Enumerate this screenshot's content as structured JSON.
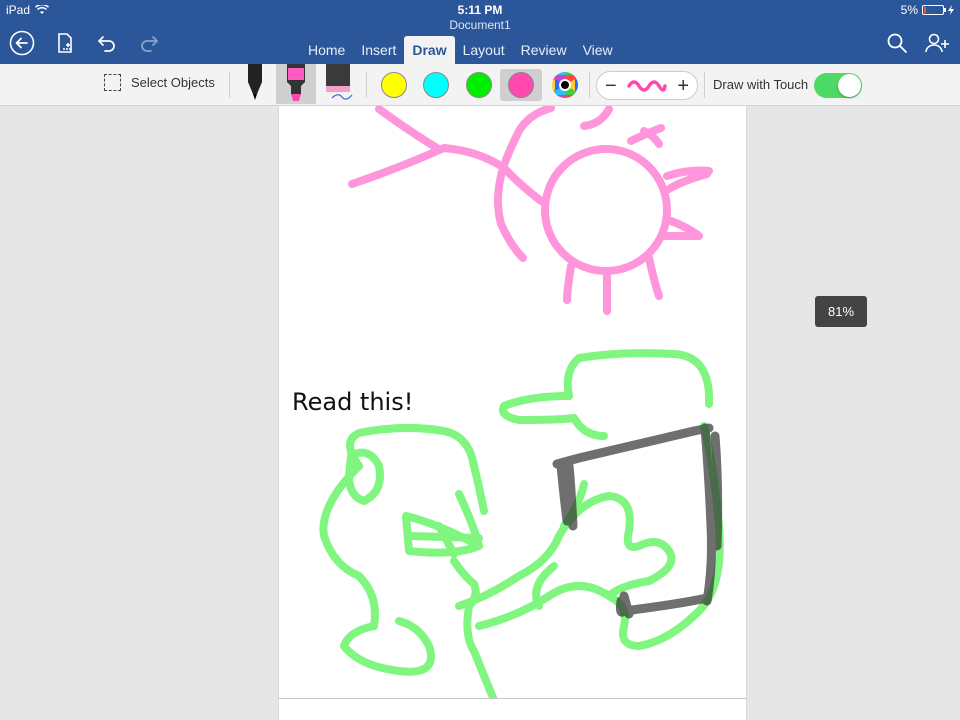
{
  "status_bar": {
    "device": "iPad",
    "time": "5:11 PM",
    "battery": "5%",
    "battery_level": 0.05
  },
  "document": {
    "title": "Document1"
  },
  "tabs": [
    {
      "label": "Home",
      "active": false
    },
    {
      "label": "Insert",
      "active": false
    },
    {
      "label": "Draw",
      "active": true
    },
    {
      "label": "Layout",
      "active": false
    },
    {
      "label": "Review",
      "active": false
    },
    {
      "label": "View",
      "active": false
    }
  ],
  "toolbar_icons": [
    "back-arrow-icon",
    "file-icon",
    "undo-icon",
    "redo-icon",
    "search-icon",
    "share-person-icon"
  ],
  "ribbon": {
    "select_objects_label": "Select Objects",
    "tools": [
      "pen",
      "highlighter",
      "pencil"
    ],
    "selected_tool": "highlighter",
    "colors": [
      "#ffff00",
      "#00ffff",
      "#00ee00",
      "#ff48b0"
    ],
    "selected_color": "#ff48b0",
    "draw_with_touch_label": "Draw with Touch",
    "draw_with_touch_on": true
  },
  "canvas": {
    "ink_text": "Read this!",
    "ink_colors": {
      "pink": "#ff8ad8",
      "green": "#6af56a",
      "dark": "#333333"
    }
  },
  "zoom": "81%",
  "colors": {
    "title_bar": "#2b579a",
    "toggle_on": "#4cd964"
  }
}
